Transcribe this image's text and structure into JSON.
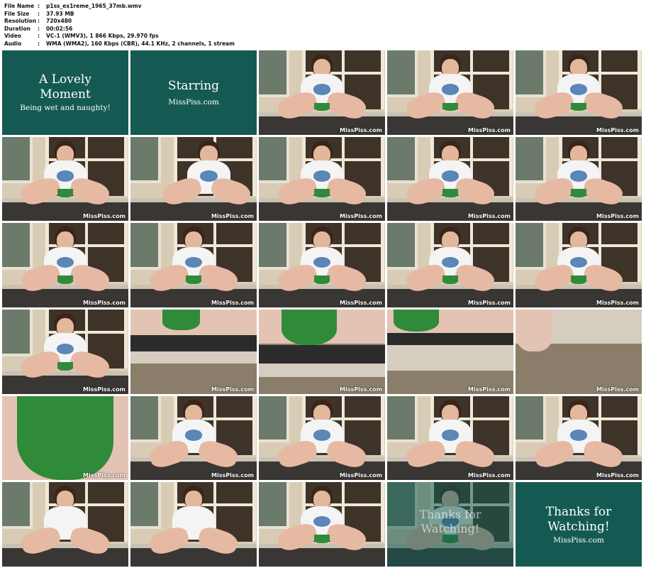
{
  "meta": [
    {
      "key": "File Name",
      "value": "p1ss_ex1reme_1965_37mb.wmv"
    },
    {
      "key": "File Size",
      "value": "37.93 MB"
    },
    {
      "key": "Resolution",
      "value": "720x480"
    },
    {
      "key": "Duration",
      "value": "00:02:56"
    },
    {
      "key": "Video",
      "value": "VC-1 (WMV3), 1 866 Kbps, 29.970 fps"
    },
    {
      "key": "Audio",
      "value": "WMA (WMA2), 160 Kbps (CBR), 44.1 KHz, 2 channels, 1 stream"
    }
  ],
  "meta_separator": ":",
  "cards": {
    "intro": {
      "line1": "A Lovely",
      "line2": "Moment",
      "line3": "Being wet and naughty!"
    },
    "starring": {
      "line1": "Starring",
      "line2": "MissPiss.com"
    },
    "outro": {
      "line1": "Thanks for",
      "line2": "Watching!",
      "line3": "MissPiss.com"
    },
    "fade_text": {
      "line1": "Thanks for",
      "line2": "Watching!"
    }
  },
  "watermark": "MissPiss.com",
  "colors": {
    "card_bg": "#145a52",
    "panty_green": "#2f8a3a",
    "shirt_logo": "#5a86b8"
  }
}
